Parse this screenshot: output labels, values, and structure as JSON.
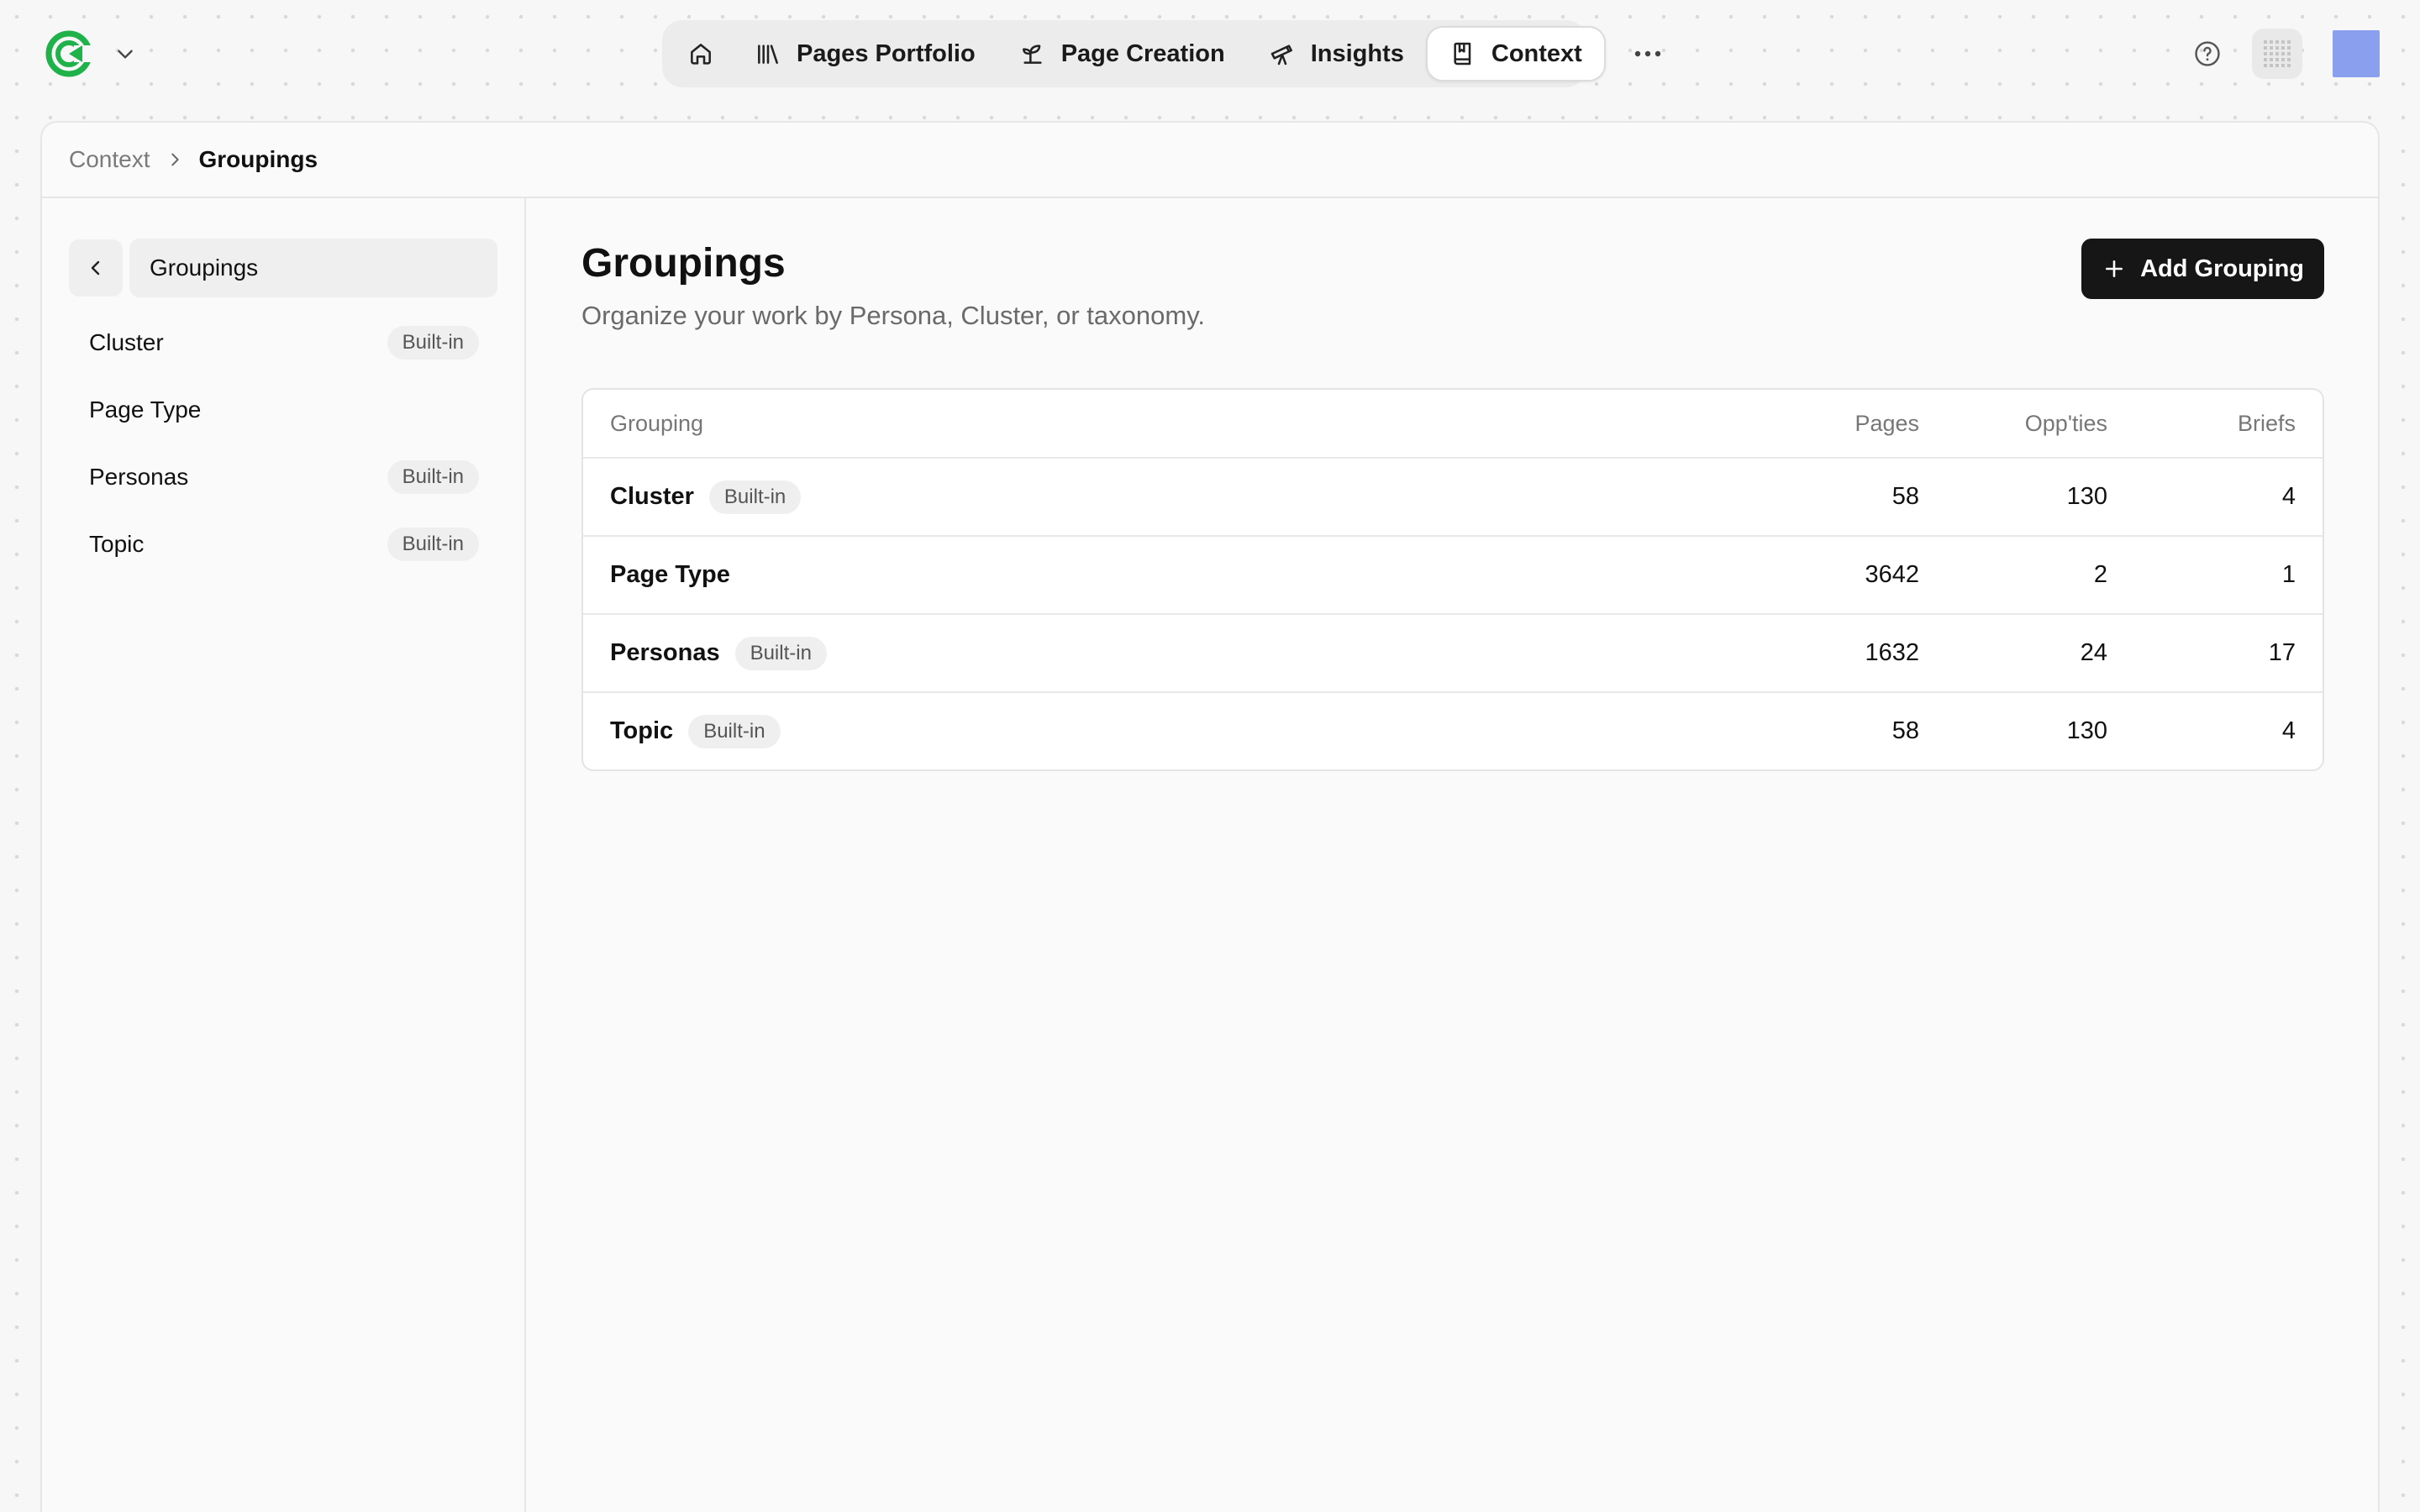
{
  "nav": {
    "items": [
      {
        "label": "Pages Portfolio",
        "icon": "library-icon"
      },
      {
        "label": "Page Creation",
        "icon": "sprout-icon"
      },
      {
        "label": "Insights",
        "icon": "telescope-icon"
      },
      {
        "label": "Context",
        "icon": "book-icon",
        "active": true
      }
    ]
  },
  "breadcrumb": {
    "root": "Context",
    "current": "Groupings"
  },
  "sidebar": {
    "title": "Groupings",
    "items": [
      {
        "label": "Cluster",
        "badge": "Built-in"
      },
      {
        "label": "Page Type",
        "badge": ""
      },
      {
        "label": "Personas",
        "badge": "Built-in"
      },
      {
        "label": "Topic",
        "badge": "Built-in"
      }
    ]
  },
  "main": {
    "title": "Groupings",
    "subtitle": "Organize your work by Persona, Cluster, or taxonomy.",
    "add_button": "Add Grouping"
  },
  "table": {
    "headers": {
      "grouping": "Grouping",
      "pages": "Pages",
      "opps": "Opp'ties",
      "briefs": "Briefs"
    },
    "rows": [
      {
        "name": "Cluster",
        "badge": "Built-in",
        "pages": "58",
        "opps": "130",
        "briefs": "4"
      },
      {
        "name": "Page Type",
        "badge": "",
        "pages": "3642",
        "opps": "2",
        "briefs": "1"
      },
      {
        "name": "Personas",
        "badge": "Built-in",
        "pages": "1632",
        "opps": "24",
        "briefs": "17"
      },
      {
        "name": "Topic",
        "badge": "Built-in",
        "pages": "58",
        "opps": "130",
        "briefs": "4"
      }
    ]
  },
  "colors": {
    "brand": "#1fb24a",
    "primary_button": "#161616",
    "avatar": "#8aa0ef",
    "badge_bg": "#efefef"
  }
}
